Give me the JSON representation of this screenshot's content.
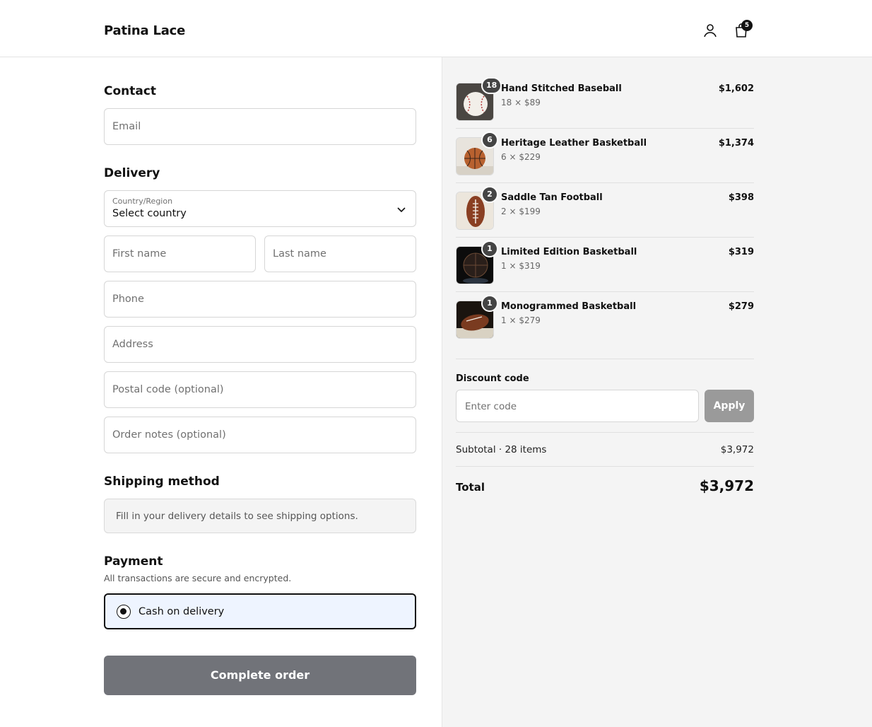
{
  "header": {
    "brand": "Patina Lace",
    "cart_count": "5"
  },
  "contact": {
    "title": "Contact",
    "email_placeholder": "Email"
  },
  "delivery": {
    "title": "Delivery",
    "country_label": "Country/Region",
    "country_value": "Select country",
    "first_name_placeholder": "First name",
    "last_name_placeholder": "Last name",
    "phone_placeholder": "Phone",
    "address_placeholder": "Address",
    "postal_placeholder": "Postal code (optional)",
    "notes_placeholder": "Order notes (optional)"
  },
  "shipping": {
    "title": "Shipping method",
    "message": "Fill in your delivery details to see shipping options."
  },
  "payment": {
    "title": "Payment",
    "subtitle": "All transactions are secure and encrypted.",
    "option_label": "Cash on delivery"
  },
  "complete_button": "Complete order",
  "items": [
    {
      "qty": "18",
      "name": "Hand Stitched Baseball",
      "sub": "18 × $89",
      "price": "$1,602",
      "icon": "baseball-icon"
    },
    {
      "qty": "6",
      "name": "Heritage Leather Basketball",
      "sub": "6 × $229",
      "price": "$1,374",
      "icon": "basketball-icon"
    },
    {
      "qty": "2",
      "name": "Saddle Tan Football",
      "sub": "2 × $199",
      "price": "$398",
      "icon": "football-icon"
    },
    {
      "qty": "1",
      "name": "Limited Edition Basketball",
      "sub": "1 × $319",
      "price": "$319",
      "icon": "basketball-icon"
    },
    {
      "qty": "1",
      "name": "Monogrammed Basketball",
      "sub": "1 × $279",
      "price": "$279",
      "icon": "football-icon"
    }
  ],
  "discount": {
    "label": "Discount code",
    "placeholder": "Enter code",
    "apply": "Apply"
  },
  "summary": {
    "subtotal_label": "Subtotal · 28 items",
    "subtotal_value": "$3,972",
    "total_label": "Total",
    "total_value": "$3,972"
  }
}
